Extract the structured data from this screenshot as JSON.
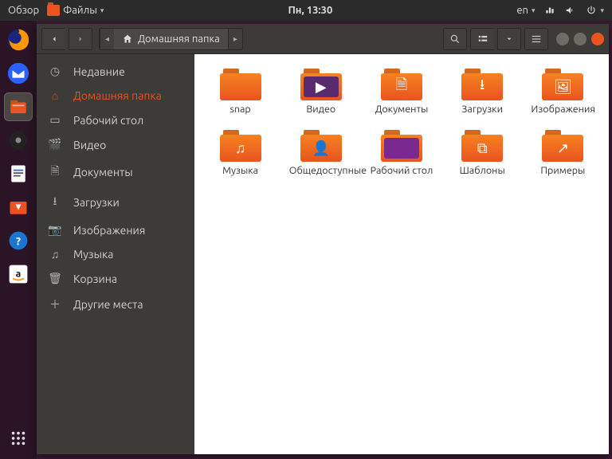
{
  "top_panel": {
    "activities": "Обзор",
    "app_menu": "Файлы",
    "clock": "Пн, 13:30",
    "lang": "en"
  },
  "window": {
    "breadcrumb": "Домашняя папка"
  },
  "sidebar": {
    "items": [
      {
        "label": "Недавние"
      },
      {
        "label": "Домашняя папка"
      },
      {
        "label": "Рабочий стол"
      },
      {
        "label": "Видео"
      },
      {
        "label": "Документы"
      },
      {
        "label": "Загрузки"
      },
      {
        "label": "Изображения"
      },
      {
        "label": "Музыка"
      },
      {
        "label": "Корзина"
      },
      {
        "label": "Другие места"
      }
    ]
  },
  "folders": [
    {
      "label": "snap"
    },
    {
      "label": "Видео"
    },
    {
      "label": "Документы"
    },
    {
      "label": "Загрузки"
    },
    {
      "label": "Изображения"
    },
    {
      "label": "Музыка"
    },
    {
      "label": "Общедоступные"
    },
    {
      "label": "Рабочий стол"
    },
    {
      "label": "Шаблоны"
    },
    {
      "label": "Примеры"
    }
  ]
}
